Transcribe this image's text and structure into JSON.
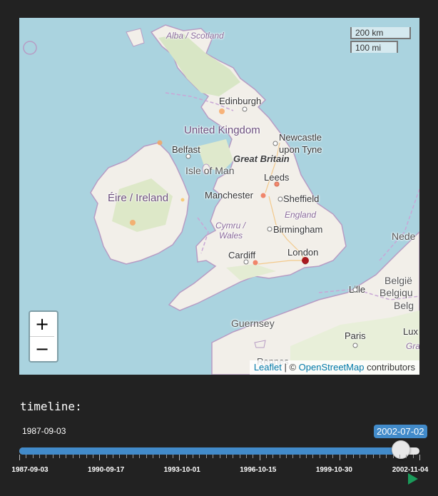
{
  "map": {
    "places": {
      "alba": "Alba / Scotland",
      "edinburgh": "Edinburgh",
      "uk": "United Kingdom",
      "newcastle1": "Newcastle",
      "newcastle2": "upon Tyne",
      "belfast": "Belfast",
      "great_britain": "Great Britain",
      "isle_of_man": "Isle of Man",
      "leeds": "Leeds",
      "eire": "Éire / Ireland",
      "manchester": "Manchester",
      "sheffield": "Sheffield",
      "england": "England",
      "cymru1": "Cymru /",
      "cymru2": "Wales",
      "birmingham": "Birmingham",
      "cardiff": "Cardiff",
      "london": "London",
      "guernsey": "Guernsey",
      "lille": "Lille",
      "paris": "Paris",
      "belgie1": "België",
      "belgie2": "Belgiqu",
      "belgie3": "Belg",
      "nede": "Nede",
      "lux": "Lux",
      "gra": "Gra",
      "rennes": "Rennes"
    },
    "scale": {
      "km": "200 km",
      "mi": "100 mi"
    },
    "zoom": {
      "in": "+",
      "out": "−"
    },
    "attribution": {
      "leaflet": "Leaflet",
      "sep": " | © ",
      "osm": "OpenStreetMap",
      "suffix": " contributors"
    },
    "marker_colors": {
      "low": "#f7a35c",
      "mid": "#ef6a4a",
      "high": "#a50f15"
    }
  },
  "timeline": {
    "label": "timeline:",
    "min": "1987-09-03",
    "current": "2002-07-02",
    "progress_fraction": 0.955,
    "tick_labels": [
      "1987-09-03",
      "1990-09-17",
      "1993-10-01",
      "1996-10-15",
      "1999-10-30",
      "2002-11-04"
    ],
    "accent": "#428bca",
    "play_color": "#1a9a5a"
  }
}
